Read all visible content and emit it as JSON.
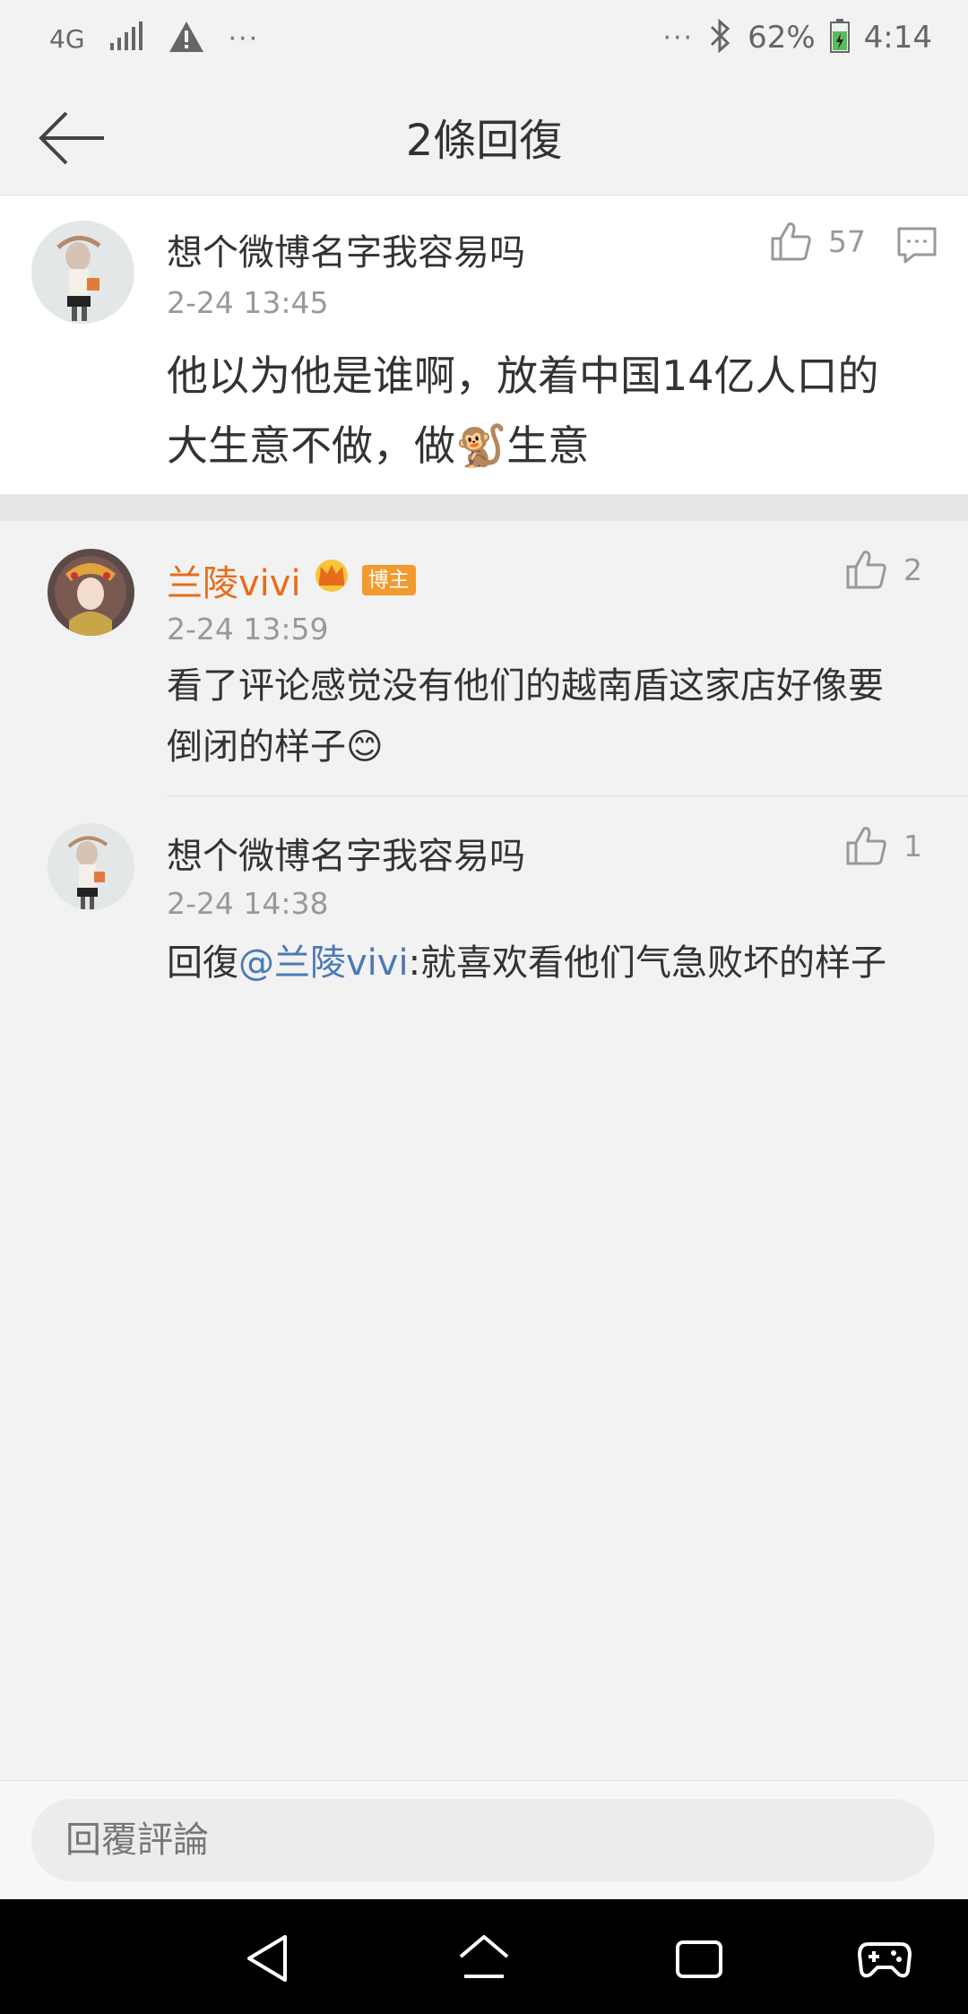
{
  "status_bar": {
    "network": "4G",
    "dots_left": "···",
    "dots_right": "···",
    "battery": "62%",
    "time": "4:14"
  },
  "header": {
    "title": "2條回復"
  },
  "main_comment": {
    "username": "想个微博名字我容易吗",
    "time": "2-24 13:45",
    "like_count": "57",
    "text_line1": "他以为他是谁啊，放着中国14亿人口的",
    "text_line2_a": "大生意不做，做",
    "text_line2_emoji": "🐒",
    "text_line2_b": "生意"
  },
  "replies": [
    {
      "username": "兰陵vivi",
      "badge": "博主",
      "time": "2-24 13:59",
      "like_count": "2",
      "text_line1": "看了评论感觉没有他们的越南盾这家店好像要",
      "text_line2": "倒闭的样子",
      "emoji": "😊"
    },
    {
      "username": "想个微博名字我容易吗",
      "time": "2-24 14:38",
      "like_count": "1",
      "prefix": "回復",
      "mention": "@兰陵vivi",
      "text": ":就喜欢看他们气急败坏的样子"
    }
  ],
  "bottom": {
    "placeholder": "回覆評論"
  },
  "colors": {
    "accent_orange": "#e86b1c",
    "mention_blue": "#4a79b6",
    "badge_bg": "#f29a2e"
  }
}
